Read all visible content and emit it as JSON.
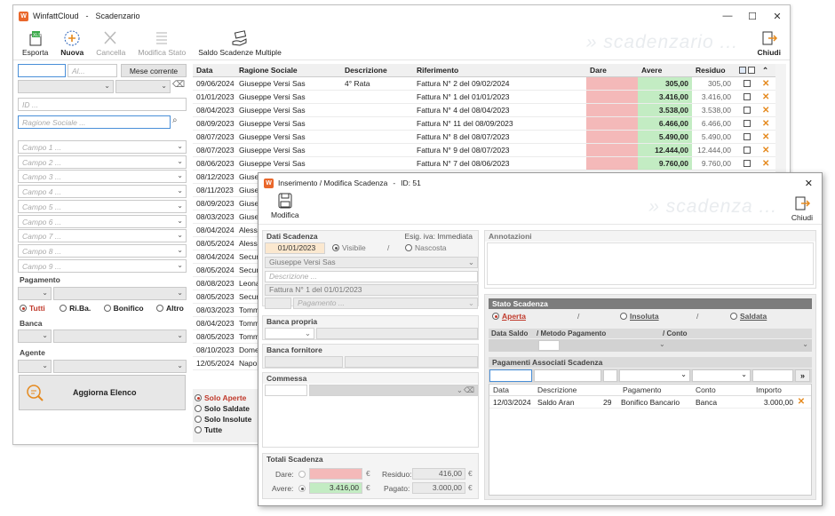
{
  "main_window": {
    "app_name": "WinfattCloud",
    "sep": "-",
    "window_title": "Scadenzario",
    "ctrl_min": "—",
    "ctrl_max": "☐",
    "ctrl_close": "✕",
    "toolbar": {
      "esporta": "Esporta",
      "nuova": "Nuova",
      "cancella": "Cancella",
      "modifica_stato": "Modifica Stato",
      "saldo": "Saldo Scadenze Multiple",
      "chiudi": "Chiudi",
      "watermark": "» scadenzario ..."
    }
  },
  "filters": {
    "date_to_placeholder": "Al...",
    "mese_corrente": "Mese corrente",
    "id_placeholder": "ID ...",
    "ragione_placeholder": "Ragione Sociale ...",
    "campi": [
      "Campo 1 ...",
      "Campo 2 ...",
      "Campo 3 ...",
      "Campo 4 ...",
      "Campo 5 ...",
      "Campo 6 ...",
      "Campo 7 ...",
      "Campo 8 ...",
      "Campo 9 ..."
    ],
    "pagamento_label": "Pagamento",
    "pag_options": [
      "Tutti",
      "Ri.Ba.",
      "Bonifico",
      "Altro"
    ],
    "banca_label": "Banca",
    "agente_label": "Agente",
    "aggiorna": "Aggiorna Elenco",
    "state_options": [
      "Solo Aperte",
      "Solo Saldate",
      "Solo Insolute",
      "Tutte"
    ]
  },
  "grid": {
    "headers": [
      "Data",
      "Ragione Sociale",
      "Descrizione",
      "Riferimento",
      "Dare",
      "Avere",
      "Residuo"
    ],
    "rows": [
      {
        "data": "09/06/2024",
        "rag": "Giuseppe Versi Sas",
        "desc": "4° Rata",
        "rif": "Fattura N° 2  del 09/02/2024",
        "avere": "305,00",
        "res": "305,00"
      },
      {
        "data": "01/01/2023",
        "rag": "Giuseppe Versi Sas",
        "desc": "",
        "rif": "Fattura N° 1  del 01/01/2023",
        "avere": "3.416,00",
        "res": "3.416,00"
      },
      {
        "data": "08/04/2023",
        "rag": "Giuseppe Versi Sas",
        "desc": "",
        "rif": "Fattura N° 4  del 08/04/2023",
        "avere": "3.538,00",
        "res": "3.538,00"
      },
      {
        "data": "08/09/2023",
        "rag": "Giuseppe Versi Sas",
        "desc": "",
        "rif": "Fattura N° 11  del 08/09/2023",
        "avere": "6.466,00",
        "res": "6.466,00"
      },
      {
        "data": "08/07/2023",
        "rag": "Giuseppe Versi Sas",
        "desc": "",
        "rif": "Fattura N° 8  del 08/07/2023",
        "avere": "5.490,00",
        "res": "5.490,00"
      },
      {
        "data": "08/07/2023",
        "rag": "Giuseppe Versi Sas",
        "desc": "",
        "rif": "Fattura N° 9  del 08/07/2023",
        "avere": "12.444,00",
        "res": "12.444,00"
      },
      {
        "data": "08/06/2023",
        "rag": "Giuseppe Versi Sas",
        "desc": "",
        "rif": "Fattura N° 7  del 08/06/2023",
        "avere": "9.760,00",
        "res": "9.760,00"
      }
    ],
    "partial_rows": [
      {
        "data": "08/12/2023",
        "rag": "Giuse"
      },
      {
        "data": "08/11/2023",
        "rag": "Giuse"
      },
      {
        "data": "08/09/2023",
        "rag": "Giuse"
      },
      {
        "data": "08/03/2023",
        "rag": "Giuse"
      },
      {
        "data": "08/04/2024",
        "rag": "Alessa"
      },
      {
        "data": "08/05/2024",
        "rag": "Alessa"
      },
      {
        "data": "08/04/2024",
        "rag": "Securi"
      },
      {
        "data": "08/05/2024",
        "rag": "Securi"
      },
      {
        "data": "08/08/2023",
        "rag": "Leona"
      },
      {
        "data": "08/05/2023",
        "rag": "Securi"
      },
      {
        "data": "08/03/2023",
        "rag": "Tomm"
      },
      {
        "data": "08/04/2023",
        "rag": "Tomm"
      },
      {
        "data": "08/05/2023",
        "rag": "Tomm"
      },
      {
        "data": "08/10/2023",
        "rag": "Dome"
      },
      {
        "data": "12/05/2024",
        "rag": "Napol"
      }
    ]
  },
  "dialog": {
    "title": "Inserimento / Modifica Scadenza",
    "sep": "-",
    "id_label": "ID: 51",
    "close": "✕",
    "modifica": "Modifica",
    "chiudi": "Chiudi",
    "watermark": "» scadenza ...",
    "dati": {
      "label": "Dati Scadenza",
      "esig": "Esig. iva: Immediata",
      "date": "01/01/2023",
      "visibile": "Visibile",
      "slash": "/",
      "nascosta": "Nascosta",
      "cliente": "Giuseppe Versi Sas",
      "descrizione_ph": "Descrizione ...",
      "riferimento": "Fattura N° 1  del 01/01/2023",
      "pagamento_ph": "Pagamento ..."
    },
    "banca_propria": "Banca propria",
    "banca_fornitore": "Banca fornitore",
    "commessa": "Commessa",
    "annotazioni": "Annotazioni",
    "totali": {
      "label": "Totali Scadenza",
      "dare": "Dare:",
      "avere": "Avere:",
      "avere_value": "3.416,00",
      "residuo": "Residuo:",
      "residuo_value": "416,00",
      "pagato": "Pagato:",
      "pagato_value": "3.000,00",
      "euro": "€"
    },
    "stato": {
      "label": "Stato Scadenza",
      "aperta": "Aperta",
      "insoluta": "Insoluta",
      "saldata": "Saldata",
      "slash": "/",
      "data_saldo": "Data Saldo",
      "metodo": "/ Metodo Pagamento",
      "conto": "/ Conto"
    },
    "pagamenti": {
      "label": "Pagamenti Associati Scadenza",
      "more": "»",
      "headers": [
        "Data",
        "Descrizione",
        "Pagamento",
        "Conto",
        "Importo"
      ],
      "rows": [
        {
          "data": "12/03/2024",
          "desc": "Saldo Aran",
          "n": "29",
          "pag": "Bonifico Bancario",
          "conto": "Banca",
          "importo": "3.000,00"
        }
      ]
    }
  }
}
